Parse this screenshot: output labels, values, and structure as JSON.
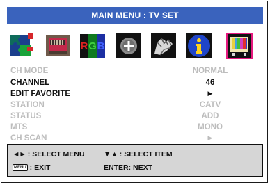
{
  "title": "MAIN MENU : TV SET",
  "icons": [
    {
      "name": "puzzle-icon"
    },
    {
      "name": "tv-screen-icon"
    },
    {
      "name": "rgb-icon",
      "letters": [
        "R",
        "G",
        "B"
      ]
    },
    {
      "name": "disc-plus-icon"
    },
    {
      "name": "hands-icon"
    },
    {
      "name": "info-icon"
    },
    {
      "name": "tv-set-icon",
      "selected": true
    }
  ],
  "menu": [
    {
      "label": "CH MODE",
      "value": "NORMAL",
      "active": false
    },
    {
      "label": "CHANNEL",
      "value": "46",
      "active": true
    },
    {
      "label": "EDIT FAVORITE",
      "value": "►",
      "active": true
    },
    {
      "label": "STATION",
      "value": "CATV",
      "active": false
    },
    {
      "label": "STATUS",
      "value": "ADD",
      "active": false
    },
    {
      "label": "MTS",
      "value": "MONO",
      "active": false
    },
    {
      "label": "CH SCAN",
      "value": "►",
      "active": false
    }
  ],
  "help": {
    "select_menu_arrows": "◄►",
    "select_menu": ": SELECT MENU",
    "select_item_arrows": "▼▲",
    "select_item": ": SELECT ITEM",
    "menu_key": "MENU",
    "exit": ": EXIT",
    "enter": "ENTER: NEXT"
  },
  "colors": {
    "title_bar": "#3a63bd",
    "selected_border": "#e5197f",
    "inactive_text": "#bdbdbd",
    "active_text": "#111111",
    "help_bg": "#d6d6d6"
  }
}
